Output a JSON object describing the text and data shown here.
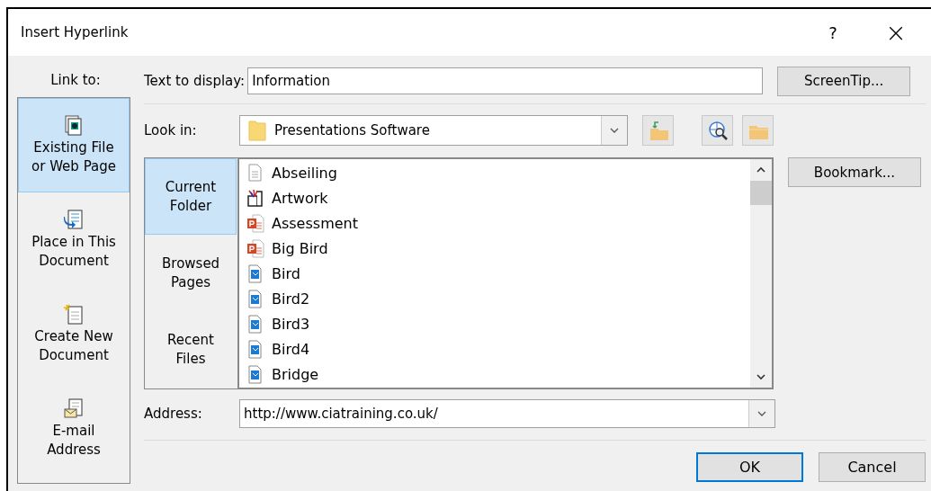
{
  "window": {
    "title": "Insert Hyperlink",
    "help": "?",
    "close": "×"
  },
  "link_to": {
    "heading": "Link to:",
    "items": [
      {
        "kind": "file",
        "label": "Existing File or Web Page",
        "selected": true
      },
      {
        "kind": "place",
        "label": "Place in This Document",
        "selected": false
      },
      {
        "kind": "new",
        "label": "Create New Document",
        "selected": false
      },
      {
        "kind": "email",
        "label": "E-mail Address",
        "selected": false
      }
    ]
  },
  "text_to_display": {
    "label": "Text to display:",
    "value": "Information"
  },
  "screentip_button": {
    "label": "ScreenTip..."
  },
  "look_in": {
    "label": "Look in:",
    "value": "Presentations Software"
  },
  "tool_buttons": [
    {
      "kind": "up"
    },
    {
      "kind": "web"
    },
    {
      "kind": "folder"
    }
  ],
  "views": [
    {
      "label": "Current Folder",
      "selected": true
    },
    {
      "label": "Browsed Pages",
      "selected": false
    },
    {
      "label": "Recent Files",
      "selected": false
    }
  ],
  "files": [
    {
      "kind": "text",
      "name": "Abseiling"
    },
    {
      "kind": "art",
      "name": "Artwork"
    },
    {
      "kind": "ppt",
      "name": "Assessment"
    },
    {
      "kind": "ppt",
      "name": "Big Bird"
    },
    {
      "kind": "image",
      "name": "Bird"
    },
    {
      "kind": "image",
      "name": "Bird2"
    },
    {
      "kind": "image",
      "name": "Bird3"
    },
    {
      "kind": "image",
      "name": "Bird4"
    },
    {
      "kind": "image",
      "name": "Bridge"
    }
  ],
  "bookmark_button": {
    "label": "Bookmark..."
  },
  "address": {
    "label": "Address:",
    "value": "http://www.ciatraining.co.uk/"
  },
  "buttons": [
    {
      "label": "OK",
      "default": true
    },
    {
      "label": "Cancel",
      "default": false
    }
  ]
}
